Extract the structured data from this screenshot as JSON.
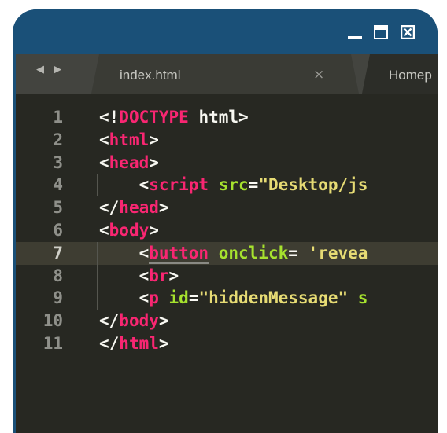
{
  "window": {
    "controls": {
      "minimize": "minimize-icon",
      "maximize": "maximize-icon",
      "close": "close-icon"
    }
  },
  "tabbar": {
    "nav_arrows": "◀ ▶",
    "tabs": [
      {
        "label": "index.html",
        "close": "×",
        "active": true
      },
      {
        "label": "Homep",
        "active": false
      }
    ]
  },
  "editor": {
    "current_line": 7,
    "lines": [
      {
        "num": "1",
        "tokens": [
          {
            "t": "<!",
            "c": "punct"
          },
          {
            "t": "DOCTYPE",
            "c": "tag"
          },
          {
            "t": " html>",
            "c": "punct"
          }
        ]
      },
      {
        "num": "2",
        "tokens": [
          {
            "t": "<",
            "c": "punct"
          },
          {
            "t": "html",
            "c": "tag"
          },
          {
            "t": ">",
            "c": "punct"
          }
        ]
      },
      {
        "num": "3",
        "tokens": [
          {
            "t": "<",
            "c": "punct"
          },
          {
            "t": "head",
            "c": "tag"
          },
          {
            "t": ">",
            "c": "punct"
          }
        ]
      },
      {
        "num": "4",
        "tokens": [
          {
            "t": "    <",
            "c": "punct"
          },
          {
            "t": "script",
            "c": "tag"
          },
          {
            "t": " ",
            "c": "punct"
          },
          {
            "t": "src",
            "c": "attr"
          },
          {
            "t": "=",
            "c": "punct"
          },
          {
            "t": "\"Desktop/js",
            "c": "str"
          }
        ]
      },
      {
        "num": "5",
        "tokens": [
          {
            "t": "</",
            "c": "punct"
          },
          {
            "t": "head",
            "c": "tag"
          },
          {
            "t": ">",
            "c": "punct"
          }
        ]
      },
      {
        "num": "6",
        "tokens": [
          {
            "t": "<",
            "c": "punct"
          },
          {
            "t": "body",
            "c": "tag"
          },
          {
            "t": ">",
            "c": "punct"
          }
        ]
      },
      {
        "num": "7",
        "tokens": [
          {
            "t": "    <",
            "c": "punct"
          },
          {
            "t": "button",
            "c": "tag underline"
          },
          {
            "t": " ",
            "c": "punct"
          },
          {
            "t": "onclick",
            "c": "attr"
          },
          {
            "t": "= ",
            "c": "punct"
          },
          {
            "t": "'revea",
            "c": "str"
          }
        ]
      },
      {
        "num": "8",
        "tokens": [
          {
            "t": "    <",
            "c": "punct"
          },
          {
            "t": "br",
            "c": "tag"
          },
          {
            "t": ">",
            "c": "punct"
          }
        ]
      },
      {
        "num": "9",
        "tokens": [
          {
            "t": "    <",
            "c": "punct"
          },
          {
            "t": "p",
            "c": "tag"
          },
          {
            "t": " ",
            "c": "punct"
          },
          {
            "t": "id",
            "c": "attr"
          },
          {
            "t": "=",
            "c": "punct"
          },
          {
            "t": "\"hiddenMessage\"",
            "c": "str"
          },
          {
            "t": " ",
            "c": "punct"
          },
          {
            "t": "s",
            "c": "attr"
          }
        ]
      },
      {
        "num": "10",
        "tokens": [
          {
            "t": "</",
            "c": "punct"
          },
          {
            "t": "body",
            "c": "tag"
          },
          {
            "t": ">",
            "c": "punct"
          }
        ]
      },
      {
        "num": "11",
        "tokens": [
          {
            "t": "</",
            "c": "punct"
          },
          {
            "t": "html",
            "c": "tag"
          },
          {
            "t": ">",
            "c": "punct"
          }
        ]
      }
    ]
  },
  "colors": {
    "window_frame": "#1a5078",
    "editor_bg": "#272822",
    "tag": "#f92672",
    "attribute": "#a6e22e",
    "string": "#e6db74",
    "text": "#f8f8f2"
  }
}
